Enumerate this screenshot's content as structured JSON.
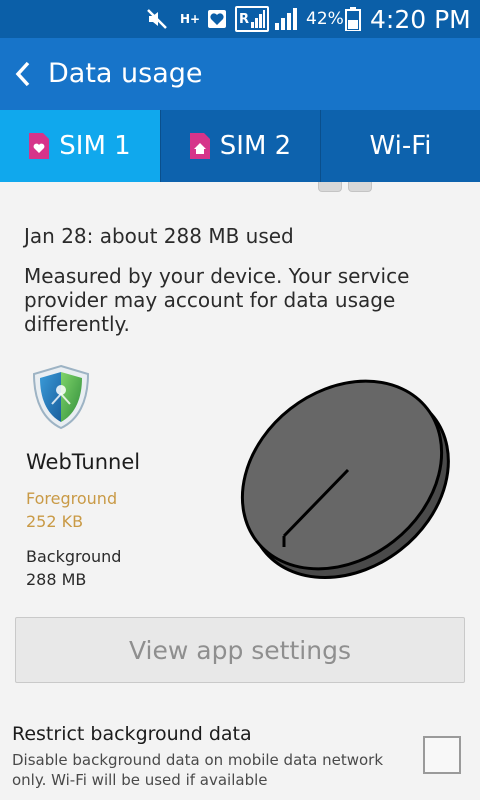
{
  "status_bar": {
    "battery_percent": "42%",
    "time": "4:20 PM",
    "network_type": "H+",
    "roaming_indicator": "R",
    "icons": [
      "mute-icon",
      "h-plus-data-icon",
      "heart-sim-icon",
      "roaming-signal-icon",
      "signal-icon",
      "battery-icon"
    ]
  },
  "header": {
    "title": "Data usage",
    "back_icon": "chevron-left-icon"
  },
  "tabs": [
    {
      "label": "SIM 1",
      "icon": "sim-heart-icon",
      "active": true
    },
    {
      "label": "SIM 2",
      "icon": "sim-home-icon",
      "active": false
    },
    {
      "label": "Wi-Fi",
      "active": false
    }
  ],
  "summary": {
    "usage": "Jan 28: about 288 MB used",
    "note": "Measured by your device. Your service provider may account for data usage differently."
  },
  "app": {
    "name": "WebTunnel",
    "icon": "webtunnel-shield-icon",
    "foreground_label": "Foreground",
    "foreground_value": "252 KB",
    "background_label": "Background",
    "background_value": "288 MB"
  },
  "pie": {
    "foreground_fraction": 0.001,
    "background_fraction": 0.999
  },
  "actions": {
    "view_app_settings": "View app settings"
  },
  "restrict": {
    "title": "Restrict background data",
    "description": "Disable background data on mobile data network only. Wi-Fi will be used if available",
    "checked": false
  },
  "colors": {
    "status_bar": "#0b5fa8",
    "app_bar": "#1774c9",
    "tab_bar": "#0d62ad",
    "tab_active": "#10a8ed",
    "foreground_text": "#c99a46",
    "sim_icon": "#d6348a",
    "pie_fill": "#676767"
  }
}
